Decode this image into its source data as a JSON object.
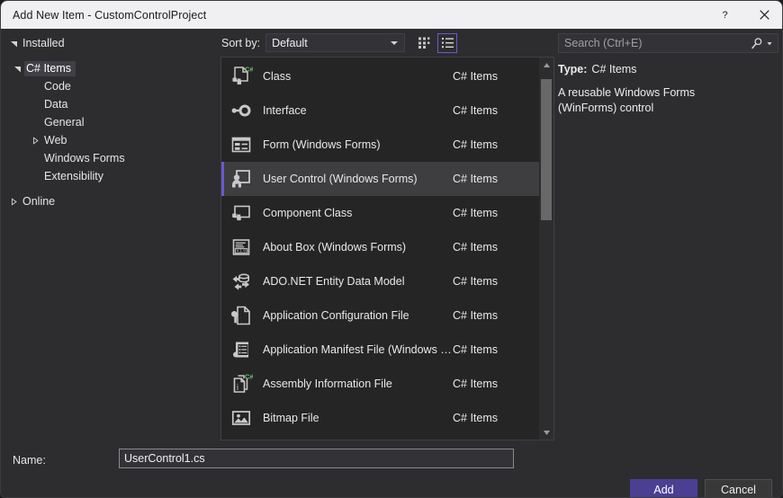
{
  "window": {
    "title": "Add New Item - CustomControlProject",
    "help_label": "?",
    "close_label": "✕",
    "help_icon": "question-mark-icon",
    "close_icon": "close-icon"
  },
  "sidebar": {
    "items": [
      {
        "label": "Installed",
        "level": 0,
        "twisty": "expanded",
        "selected": false
      },
      {
        "label": "C# Items",
        "level": 1,
        "twisty": "expanded",
        "selected": true
      },
      {
        "label": "Code",
        "level": 2,
        "twisty": "none",
        "selected": false
      },
      {
        "label": "Data",
        "level": 2,
        "twisty": "none",
        "selected": false
      },
      {
        "label": "General",
        "level": 2,
        "twisty": "none",
        "selected": false
      },
      {
        "label": "Web",
        "level": 2,
        "twisty": "collapsed",
        "selected": false
      },
      {
        "label": "Windows Forms",
        "level": 2,
        "twisty": "none",
        "selected": false
      },
      {
        "label": "Extensibility",
        "level": 2,
        "twisty": "none",
        "selected": false
      },
      {
        "label": "Online",
        "level": 0,
        "twisty": "collapsed",
        "selected": false
      }
    ]
  },
  "toolbar": {
    "sort_by_label": "Sort by:",
    "sort_value": "Default",
    "sort_options": [
      "Default"
    ],
    "grid_view_title": "Medium Icons",
    "list_view_title": "List",
    "grid_view_icon": "grid-view-icon",
    "list_view_icon": "list-view-icon",
    "active_view": "list"
  },
  "list": {
    "items": [
      {
        "name": "Class",
        "category": "C# Items",
        "icon": "class-icon",
        "selected": false
      },
      {
        "name": "Interface",
        "category": "C# Items",
        "icon": "interface-icon",
        "selected": false
      },
      {
        "name": "Form (Windows Forms)",
        "category": "C# Items",
        "icon": "form-icon",
        "selected": false
      },
      {
        "name": "User Control (Windows Forms)",
        "category": "C# Items",
        "icon": "usercontrol-icon",
        "selected": true
      },
      {
        "name": "Component Class",
        "category": "C# Items",
        "icon": "component-icon",
        "selected": false
      },
      {
        "name": "About Box (Windows Forms)",
        "category": "C# Items",
        "icon": "aboutbox-icon",
        "selected": false
      },
      {
        "name": "ADO.NET Entity Data Model",
        "category": "C# Items",
        "icon": "entitymodel-icon",
        "selected": false
      },
      {
        "name": "Application Configuration File",
        "category": "C# Items",
        "icon": "appconfig-icon",
        "selected": false
      },
      {
        "name": "Application Manifest File (Windows Only)",
        "category": "C# Items",
        "icon": "manifest-icon",
        "selected": false
      },
      {
        "name": "Assembly Information File",
        "category": "C# Items",
        "icon": "assemblyinfo-icon",
        "selected": false
      },
      {
        "name": "Bitmap File",
        "category": "C# Items",
        "icon": "bitmap-icon",
        "selected": false
      }
    ],
    "scrollbar": {
      "thumb_top_pct": 2,
      "thumb_height_pct": 40
    }
  },
  "search": {
    "placeholder": "Search (Ctrl+E)",
    "value": "",
    "icon": "search-icon",
    "dropdown_icon": "chevron-down-icon"
  },
  "details": {
    "type_label": "Type:",
    "type_value": "C# Items",
    "description": "A reusable Windows Forms (WinForms) control"
  },
  "footer": {
    "name_label": "Name:",
    "name_value": "UserControl1.cs",
    "name_placeholder": "",
    "add_label": "Add",
    "cancel_label": "Cancel"
  },
  "colors": {
    "titlebar_bg": "#f0f0f2",
    "dialog_bg": "#2d2d30",
    "list_bg": "#252526",
    "selection_bg": "#3e3e40",
    "accent": "#6a5acd",
    "primary_button": "#4a3f93",
    "icon_gray": "#c8c8c8",
    "csharp_green": "#6fbf73"
  }
}
